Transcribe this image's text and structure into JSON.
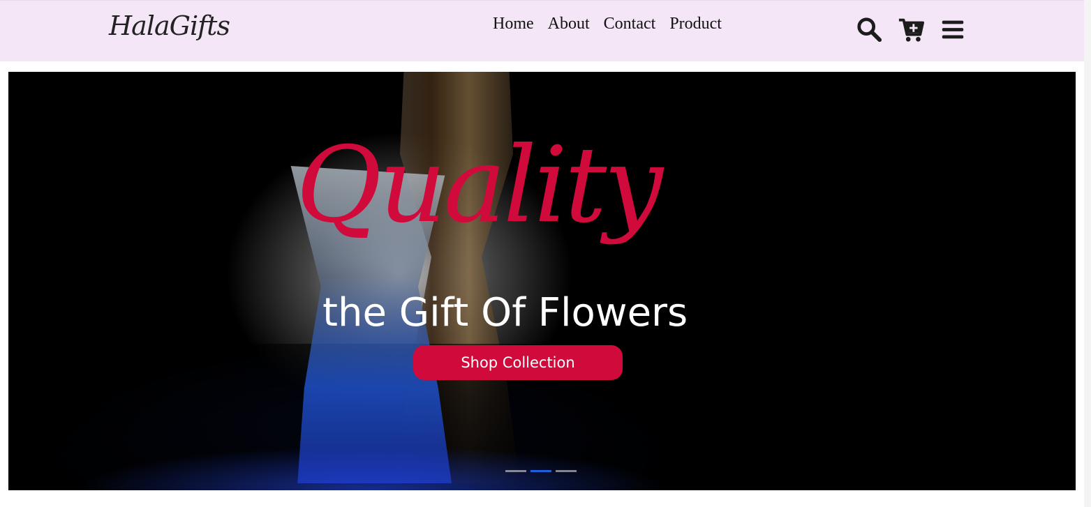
{
  "brand": {
    "logo_text": "HalaGifts"
  },
  "nav": {
    "links": [
      {
        "label": "Home"
      },
      {
        "label": "About"
      },
      {
        "label": "Contact"
      },
      {
        "label": "Product"
      }
    ],
    "icons": [
      "search-icon",
      "cart-plus-icon",
      "menu-icon"
    ]
  },
  "hero": {
    "title": "Quality",
    "subtitle": "the Gift Of Flowers",
    "button_label": "Shop Collection",
    "slides": 3,
    "active_slide": 2
  },
  "colors": {
    "navbar_bg": "#f5e6f7",
    "accent": "#d10a3c",
    "hero_bg": "#000000",
    "indicator_active": "#1f5fd8"
  }
}
